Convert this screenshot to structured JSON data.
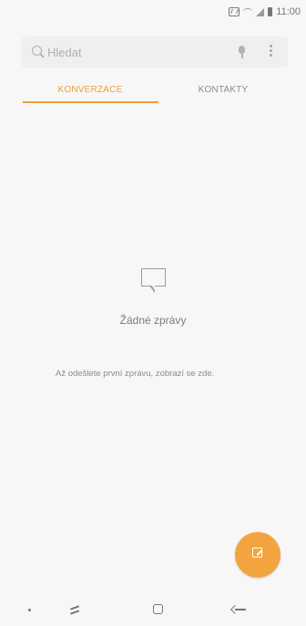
{
  "status_bar": {
    "time": "11:00",
    "icons": [
      "nfc-icon",
      "wifi-icon",
      "signal-icon",
      "battery-icon"
    ]
  },
  "search": {
    "placeholder": "Hledat",
    "value": "",
    "icons": [
      "search-icon",
      "mic-icon",
      "menu-icon"
    ]
  },
  "tabs": {
    "conversations": "KONVERZACE",
    "contacts": "KONTAKTY",
    "active": "KONVERZACE"
  },
  "empty_state": {
    "icon": "speech-bubble-icon",
    "title": "Žádné zprávy",
    "description": "Až odešlete první zprávu, zobrazí se zde."
  },
  "fab": {
    "icon": "compose-icon",
    "color": "#f4a43f"
  },
  "navigation": {
    "icons": [
      "recent-apps-icon",
      "home-icon",
      "back-icon"
    ]
  },
  "colors": {
    "accent": "#f39b35",
    "background": "#f7f7f7",
    "search_background": "#efefef"
  }
}
